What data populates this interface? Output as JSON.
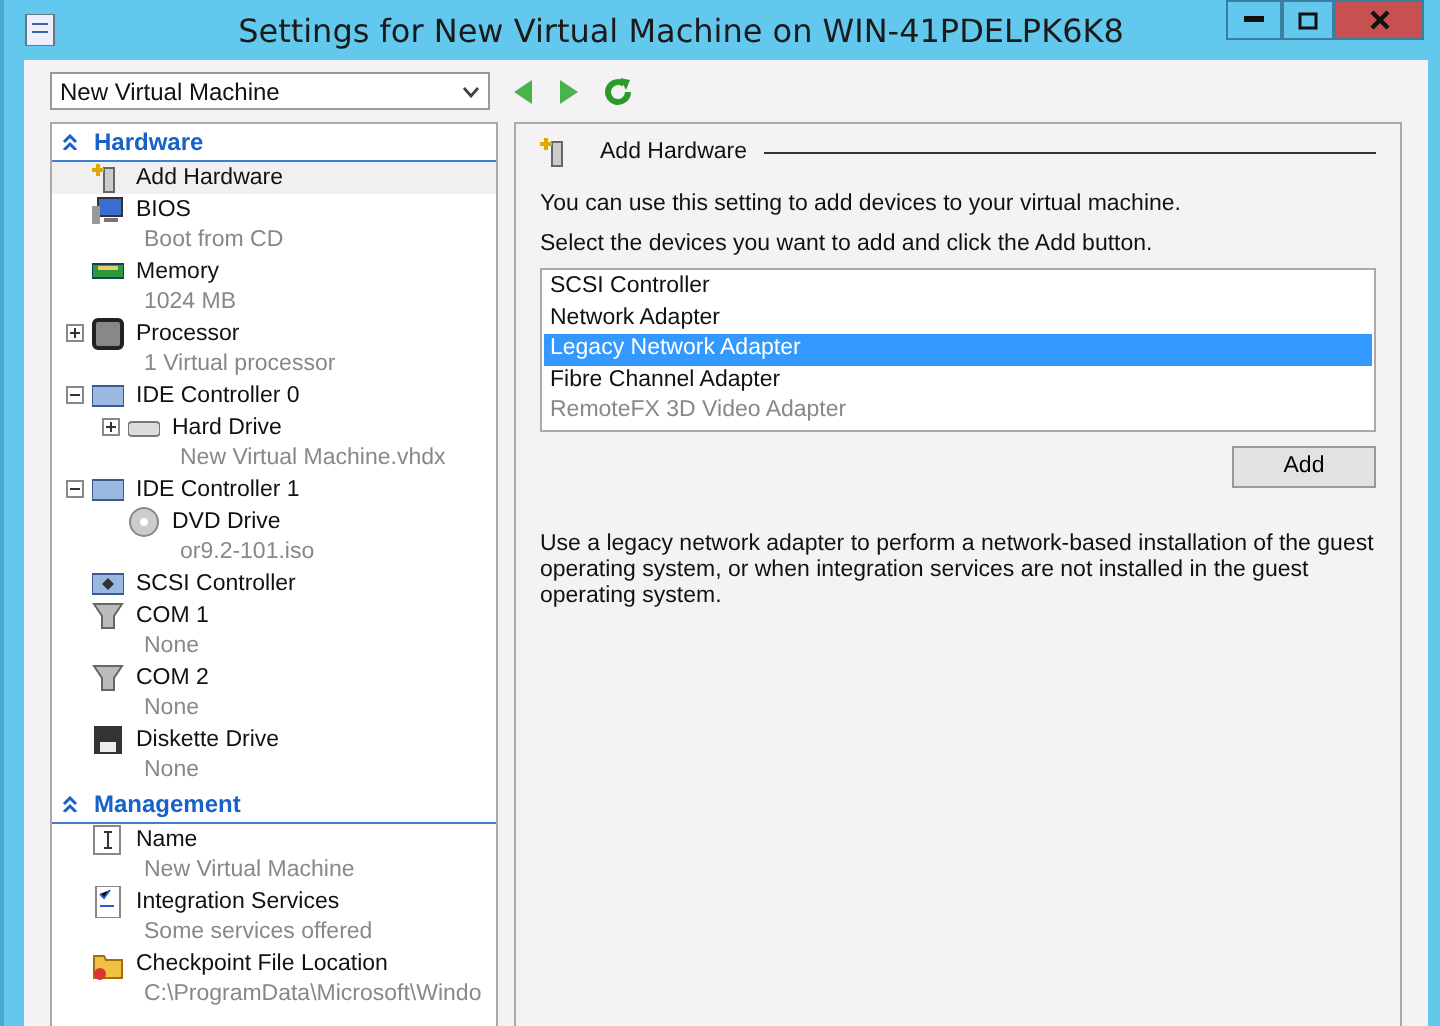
{
  "window": {
    "title": "Settings for New Virtual Machine on WIN-41PDELPK6K8"
  },
  "vm_selector": {
    "value": "New Virtual Machine"
  },
  "sections": [
    {
      "label": "Hardware",
      "expanded": true,
      "items": [
        {
          "kind": "add",
          "label": "Add Hardware",
          "selected": true
        },
        {
          "kind": "bios",
          "label": "BIOS",
          "detail": "Boot from CD",
          "selected": false
        },
        {
          "kind": "memory",
          "label": "Memory",
          "detail": "1024 MB",
          "selected": false
        },
        {
          "kind": "processor",
          "label": "Processor",
          "detail": "1 Virtual processor",
          "expanded": false,
          "selected": false
        },
        {
          "kind": "controller",
          "label": "IDE Controller 0",
          "expanded": true,
          "selected": false,
          "children": [
            {
              "kind": "disk",
              "label": "Hard Drive",
              "detail": "New Virtual Machine.vhdx",
              "expanded": false,
              "selected": false
            }
          ]
        },
        {
          "kind": "controller",
          "label": "IDE Controller 1",
          "expanded": true,
          "selected": false,
          "children": [
            {
              "kind": "dvd",
              "label": "DVD Drive",
              "detail": "or9.2-101.iso",
              "selected": false
            }
          ]
        },
        {
          "kind": "scsi",
          "label": "SCSI Controller",
          "selected": false
        },
        {
          "kind": "port",
          "label": "COM 1",
          "detail": "None",
          "selected": false
        },
        {
          "kind": "port",
          "label": "COM 2",
          "detail": "None",
          "selected": false
        },
        {
          "kind": "floppy",
          "label": "Diskette Drive",
          "detail": "None",
          "selected": false
        }
      ]
    },
    {
      "label": "Management",
      "expanded": true,
      "items": [
        {
          "kind": "name",
          "label": "Name",
          "detail": "New Virtual Machine",
          "selected": false
        },
        {
          "kind": "services",
          "label": "Integration Services",
          "detail": "Some services offered",
          "selected": false
        },
        {
          "kind": "folder",
          "label": "Checkpoint File Location",
          "detail": "C:\\ProgramData\\Microsoft\\Windo",
          "selected": false
        }
      ]
    }
  ],
  "panel": {
    "title": "Add Hardware",
    "intro": "You can use this setting to add devices to your virtual machine.",
    "prompt": "Select the devices you want to add and click the Add button.",
    "devices": [
      {
        "label": "SCSI Controller",
        "selected": false,
        "disabled": false
      },
      {
        "label": "Network Adapter",
        "selected": false,
        "disabled": false
      },
      {
        "label": "Legacy Network Adapter",
        "selected": true,
        "disabled": false
      },
      {
        "label": "Fibre Channel Adapter",
        "selected": false,
        "disabled": false
      },
      {
        "label": "RemoteFX 3D Video Adapter",
        "selected": false,
        "disabled": true
      }
    ],
    "button": "Add",
    "description": "Use a legacy network adapter to perform a network-based installation of the guest operating system, or when integration services are not installed in the guest operating system."
  }
}
